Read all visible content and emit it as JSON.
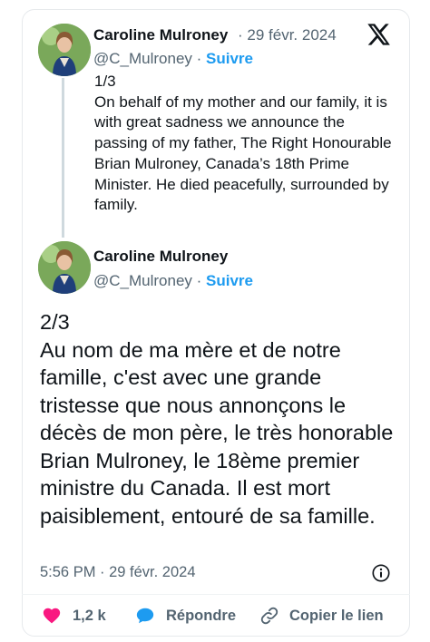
{
  "tweet1": {
    "author_name": "Caroline Mulroney",
    "date": "· 29 févr. 2024",
    "handle": "@C_Mulroney",
    "separator": " · ",
    "follow_label": "Suivre",
    "text": "1/3\nOn behalf of my mother and our family, it is with great sadness we announce the passing of my father, The Right Honourable Brian Mulroney, Canada’s 18th Prime Minister. He died peacefully, surrounded by family."
  },
  "tweet2": {
    "author_name": "Caroline Mulroney",
    "handle": "@C_Mulroney",
    "separator": " · ",
    "follow_label": "Suivre",
    "text": "2/3\nAu nom de ma mère et de notre famille, c'est avec une grande tristesse que nous annonçons le décès de mon père, le très honorable Brian Mulroney, le 18ème premier ministre du Canada. Il est mort paisiblement, entouré de sa famille.",
    "timestamp": "5:56 PM · 29 févr. 2024"
  },
  "actions": {
    "likes": "1,2 k",
    "reply_label": "Répondre",
    "copy_link_label": "Copier le lien"
  },
  "icons": {
    "brand": "x-logo-icon",
    "info": "info-icon",
    "like": "heart-icon",
    "reply": "speech-bubble-icon",
    "copy": "link-icon"
  },
  "colors": {
    "link_blue": "#1d9bf0",
    "heart_red": "#f91880",
    "muted_text": "#536471"
  }
}
